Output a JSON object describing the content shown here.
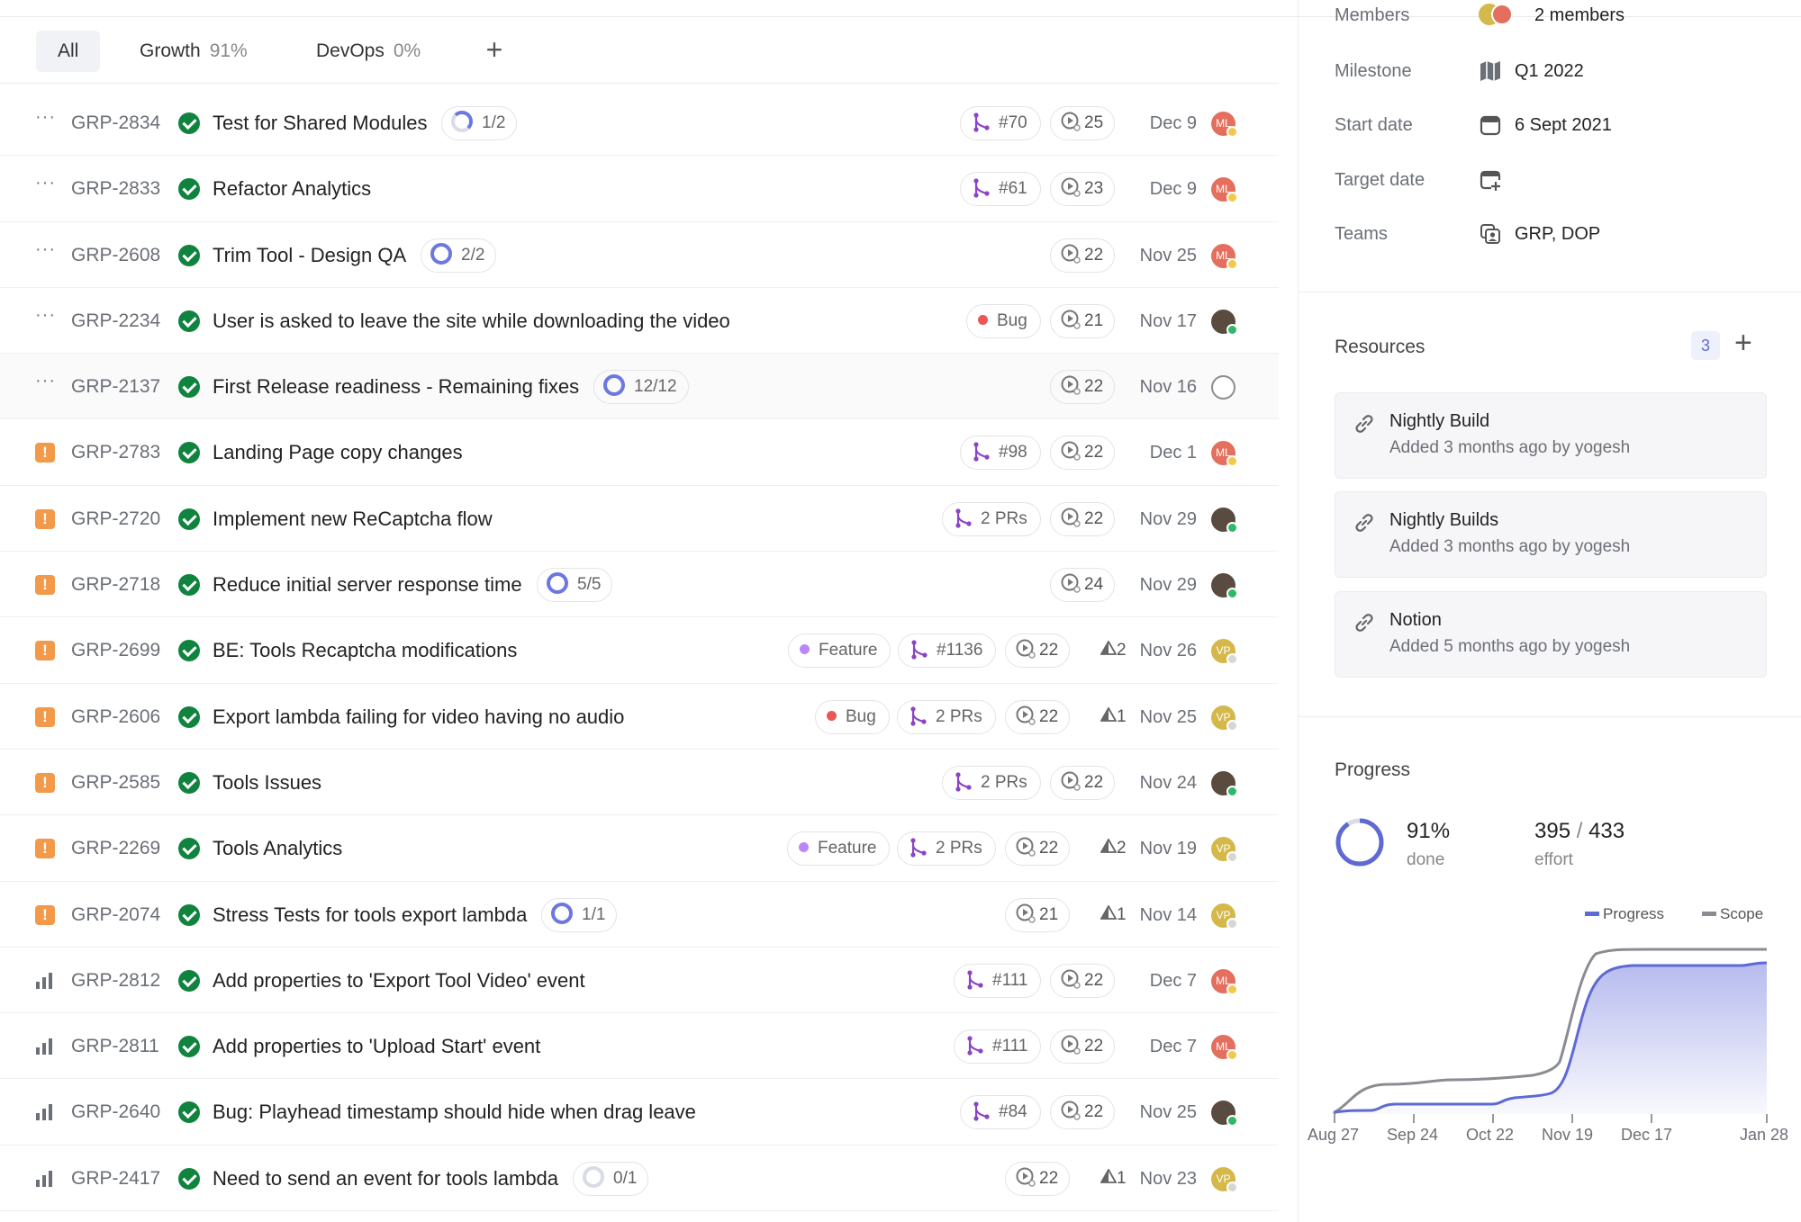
{
  "tabs": [
    {
      "label": "All",
      "pct": ""
    },
    {
      "label": "Growth",
      "pct": "91%"
    },
    {
      "label": "DevOps",
      "pct": "0%"
    }
  ],
  "issues": [
    {
      "priority": "none",
      "id": "GRP-2834",
      "title": "Test for Shared Modules",
      "sub": "1/2",
      "ring": "partial",
      "labels": [],
      "pr": "#70",
      "est": "25",
      "rel": "",
      "date": "Dec 9",
      "avatar": "ml",
      "avatar_text": "ML"
    },
    {
      "priority": "none",
      "id": "GRP-2833",
      "title": "Refactor Analytics",
      "sub": "",
      "ring": "",
      "labels": [],
      "pr": "#61",
      "est": "23",
      "rel": "",
      "date": "Dec 9",
      "avatar": "ml",
      "avatar_text": "ML"
    },
    {
      "priority": "none",
      "id": "GRP-2608",
      "title": "Trim Tool - Design QA",
      "sub": "2/2",
      "ring": "full",
      "labels": [],
      "pr": "",
      "est": "22",
      "rel": "",
      "date": "Nov 25",
      "avatar": "ml",
      "avatar_text": "ML"
    },
    {
      "priority": "none",
      "id": "GRP-2234",
      "title": "User is asked to leave the site while downloading the video",
      "sub": "",
      "ring": "",
      "labels": [
        {
          "text": "Bug",
          "color": "#eb5757"
        }
      ],
      "pr": "",
      "est": "21",
      "rel": "",
      "date": "Nov 17",
      "avatar": "ph",
      "avatar_text": ""
    },
    {
      "priority": "none",
      "id": "GRP-2137",
      "title": "First Release readiness - Remaining fixes",
      "sub": "12/12",
      "ring": "full",
      "labels": [],
      "pr": "",
      "est": "22",
      "rel": "",
      "date": "Nov 16",
      "avatar": "empty",
      "avatar_text": ""
    },
    {
      "priority": "urgent",
      "id": "GRP-2783",
      "title": "Landing Page copy changes",
      "sub": "",
      "ring": "",
      "labels": [],
      "pr": "#98",
      "est": "22",
      "rel": "",
      "date": "Dec 1",
      "avatar": "ml",
      "avatar_text": "ML"
    },
    {
      "priority": "urgent",
      "id": "GRP-2720",
      "title": "Implement new ReCaptcha flow",
      "sub": "",
      "ring": "",
      "labels": [],
      "pr": "2 PRs",
      "est": "22",
      "rel": "",
      "date": "Nov 29",
      "avatar": "ph",
      "avatar_text": ""
    },
    {
      "priority": "urgent",
      "id": "GRP-2718",
      "title": "Reduce initial server response time",
      "sub": "5/5",
      "ring": "full",
      "labels": [],
      "pr": "",
      "est": "24",
      "rel": "",
      "date": "Nov 29",
      "avatar": "ph",
      "avatar_text": ""
    },
    {
      "priority": "urgent",
      "id": "GRP-2699",
      "title": "BE: Tools Recaptcha modifications",
      "sub": "",
      "ring": "",
      "labels": [
        {
          "text": "Feature",
          "color": "#bb87fc"
        }
      ],
      "pr": "#1136",
      "est": "22",
      "rel": "2",
      "date": "Nov 26",
      "avatar": "vp",
      "avatar_text": "VP"
    },
    {
      "priority": "urgent",
      "id": "GRP-2606",
      "title": "Export lambda failing for video having no audio",
      "sub": "",
      "ring": "",
      "labels": [
        {
          "text": "Bug",
          "color": "#eb5757"
        }
      ],
      "pr": "2 PRs",
      "est": "22",
      "rel": "1",
      "date": "Nov 25",
      "avatar": "vp",
      "avatar_text": "VP"
    },
    {
      "priority": "urgent",
      "id": "GRP-2585",
      "title": "Tools Issues",
      "sub": "",
      "ring": "",
      "labels": [],
      "pr": "2 PRs",
      "est": "22",
      "rel": "",
      "date": "Nov 24",
      "avatar": "ph",
      "avatar_text": ""
    },
    {
      "priority": "urgent",
      "id": "GRP-2269",
      "title": "Tools Analytics",
      "sub": "",
      "ring": "",
      "labels": [
        {
          "text": "Feature",
          "color": "#bb87fc"
        }
      ],
      "pr": "2 PRs",
      "est": "22",
      "rel": "2",
      "date": "Nov 19",
      "avatar": "vp",
      "avatar_text": "VP"
    },
    {
      "priority": "urgent",
      "id": "GRP-2074",
      "title": "Stress Tests for tools export lambda",
      "sub": "1/1",
      "ring": "full",
      "labels": [],
      "pr": "",
      "est": "21",
      "rel": "1",
      "date": "Nov 14",
      "avatar": "vp",
      "avatar_text": "VP"
    },
    {
      "priority": "bars",
      "id": "GRP-2812",
      "title": "Add properties to 'Export Tool Video' event",
      "sub": "",
      "ring": "",
      "labels": [],
      "pr": "#111",
      "est": "22",
      "rel": "",
      "date": "Dec 7",
      "avatar": "ml",
      "avatar_text": "ML"
    },
    {
      "priority": "bars",
      "id": "GRP-2811",
      "title": "Add properties to 'Upload Start' event",
      "sub": "",
      "ring": "",
      "labels": [],
      "pr": "#111",
      "est": "22",
      "rel": "",
      "date": "Dec 7",
      "avatar": "ml",
      "avatar_text": "ML"
    },
    {
      "priority": "bars",
      "id": "GRP-2640",
      "title": "Bug: Playhead timestamp should hide when drag leave",
      "sub": "",
      "ring": "",
      "labels": [],
      "pr": "#84",
      "est": "22",
      "rel": "",
      "date": "Nov 25",
      "avatar": "ph",
      "avatar_text": ""
    },
    {
      "priority": "bars",
      "id": "GRP-2417",
      "title": "Need to send an event for tools lambda",
      "sub": "0/1",
      "ring": "empty",
      "labels": [],
      "pr": "",
      "est": "22",
      "rel": "1",
      "date": "Nov 23",
      "avatar": "vp",
      "avatar_text": "VP"
    }
  ],
  "details": {
    "members_label": "Members",
    "members_value": "2 members",
    "milestone_label": "Milestone",
    "milestone_value": "Q1 2022",
    "start_label": "Start date",
    "start_value": "6 Sept 2021",
    "target_label": "Target date",
    "teams_label": "Teams",
    "teams_value": "GRP, DOP"
  },
  "resources": {
    "title": "Resources",
    "count": "3",
    "items": [
      {
        "title": "Nightly Build",
        "subtitle": "Added 3 months ago by yogesh"
      },
      {
        "title": "Nightly Builds",
        "subtitle": "Added 3 months ago by yogesh"
      },
      {
        "title": "Notion",
        "subtitle": "Added 5 months ago by yogesh"
      }
    ]
  },
  "progress": {
    "title": "Progress",
    "percent": "91%",
    "percent_label": "done",
    "effort_done": "395",
    "effort_total": "433",
    "effort_label": "effort",
    "progress_fraction": 0.91
  },
  "chart_data": {
    "type": "area",
    "x": [
      "Aug 27",
      "Sep 24",
      "Oct 22",
      "Nov 19",
      "Dec 17",
      "Jan 28"
    ],
    "series": [
      {
        "name": "Progress",
        "color": "#5e6ad2",
        "values": [
          0,
          10,
          20,
          80,
          370,
          395
        ]
      },
      {
        "name": "Scope",
        "color": "#8a8c92",
        "values": [
          0,
          70,
          90,
          130,
          420,
          433
        ]
      }
    ],
    "legend_position": "top-right",
    "grid": false
  },
  "colors": {
    "accent": "#5e6ad2",
    "done": "#10833f",
    "urgent": "#f2994a",
    "pr": "#8b44c5"
  }
}
